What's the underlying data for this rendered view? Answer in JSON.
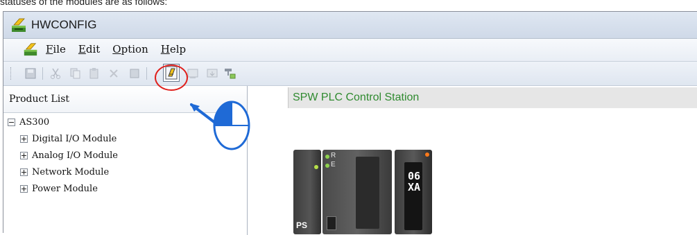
{
  "document": {
    "caption_fragment": "statuses of the modules are as follows:"
  },
  "window": {
    "title": "HWCONFIG",
    "icon": "hwconfig-app-icon"
  },
  "menu": {
    "items": [
      {
        "label": "File",
        "mnemonic": "F",
        "rest": "ile"
      },
      {
        "label": "Edit",
        "mnemonic": "E",
        "rest": "dit"
      },
      {
        "label": "Option",
        "mnemonic": "O",
        "rest": "ption"
      },
      {
        "label": "Help",
        "mnemonic": "H",
        "rest": "elp"
      }
    ]
  },
  "toolbar": {
    "highlighted_button_icon": "online-mode-icon",
    "highlight_color": "#e0201c"
  },
  "product_list": {
    "title": "Product List",
    "root": {
      "label": "AS300",
      "expanded": true
    },
    "children": [
      {
        "label": "Digital I/O Module",
        "expanded": false
      },
      {
        "label": "Analog I/O Module",
        "expanded": false
      },
      {
        "label": "Network Module",
        "expanded": false
      },
      {
        "label": "Power Module",
        "expanded": false
      }
    ]
  },
  "station": {
    "label": "SPW PLC Control Station",
    "label_color": "#2f8a2f"
  },
  "rack": {
    "power_module_label": "PS",
    "cpu_leds": [
      "R",
      "E"
    ],
    "io_module_label_top": "06",
    "io_module_label_bottom": "XA"
  }
}
